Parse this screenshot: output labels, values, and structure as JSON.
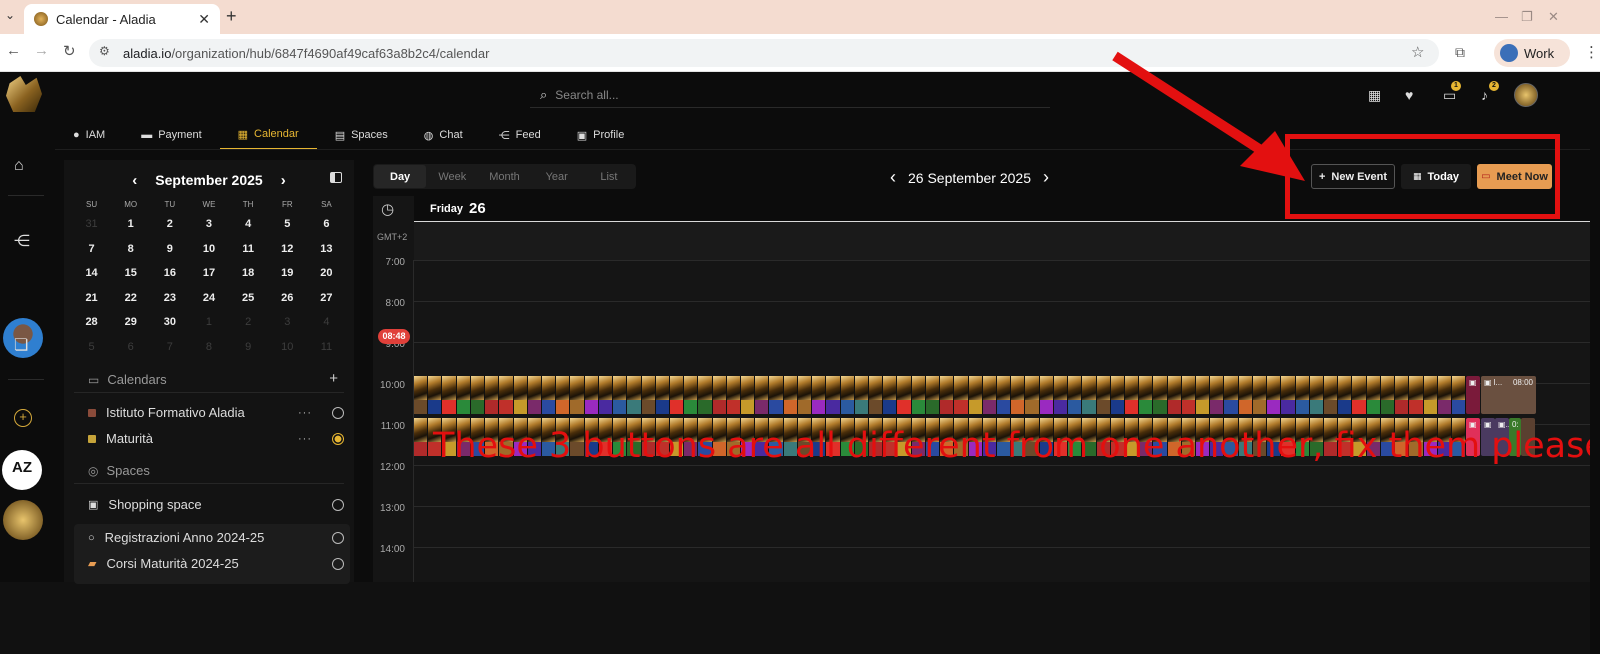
{
  "browser": {
    "tab_title": "Calendar - Aladia",
    "url_host": "aladia.io",
    "url_path": "/organization/hub/6847f4690af49caf63a8b2c4/calendar",
    "profile_label": "Work"
  },
  "header": {
    "search_placeholder": "Search all...",
    "chat_badge": "1",
    "notif_badge": "2"
  },
  "nav_tabs": [
    {
      "label": "IAM",
      "icon": "user-icon"
    },
    {
      "label": "Payment",
      "icon": "card-icon"
    },
    {
      "label": "Calendar",
      "icon": "calendar-icon",
      "active": true
    },
    {
      "label": "Spaces",
      "icon": "spaces-icon"
    },
    {
      "label": "Chat",
      "icon": "chat-icon"
    },
    {
      "label": "Feed",
      "icon": "share-icon"
    },
    {
      "label": "Profile",
      "icon": "profile-card-icon"
    }
  ],
  "mini_calendar": {
    "month_label": "September 2025",
    "weekdays": [
      "SU",
      "MO",
      "TU",
      "WE",
      "TH",
      "FR",
      "SA"
    ],
    "days": [
      {
        "d": "31",
        "dim": true
      },
      {
        "d": "1"
      },
      {
        "d": "2"
      },
      {
        "d": "3"
      },
      {
        "d": "4"
      },
      {
        "d": "5"
      },
      {
        "d": "6"
      },
      {
        "d": "7"
      },
      {
        "d": "8"
      },
      {
        "d": "9"
      },
      {
        "d": "10"
      },
      {
        "d": "11"
      },
      {
        "d": "12"
      },
      {
        "d": "13"
      },
      {
        "d": "14"
      },
      {
        "d": "15"
      },
      {
        "d": "16"
      },
      {
        "d": "17"
      },
      {
        "d": "18"
      },
      {
        "d": "19"
      },
      {
        "d": "20"
      },
      {
        "d": "21"
      },
      {
        "d": "22"
      },
      {
        "d": "23"
      },
      {
        "d": "24"
      },
      {
        "d": "25"
      },
      {
        "d": "26"
      },
      {
        "d": "27"
      },
      {
        "d": "28"
      },
      {
        "d": "29"
      },
      {
        "d": "30"
      },
      {
        "d": "1",
        "dim": true
      },
      {
        "d": "2",
        "dim": true
      },
      {
        "d": "3",
        "dim": true
      },
      {
        "d": "4",
        "dim": true
      },
      {
        "d": "5",
        "dim": true
      },
      {
        "d": "6",
        "dim": true
      },
      {
        "d": "7",
        "dim": true
      },
      {
        "d": "8",
        "dim": true
      },
      {
        "d": "9",
        "dim": true
      },
      {
        "d": "10",
        "dim": true
      },
      {
        "d": "11",
        "dim": true
      }
    ]
  },
  "calendars_section": {
    "title": "Calendars",
    "items": [
      {
        "label": "Istituto Formativo Aladia",
        "color": "#8a4b3a",
        "selected": false
      },
      {
        "label": "Maturità",
        "color": "#c6a43a",
        "selected": true
      }
    ]
  },
  "spaces_section": {
    "title": "Spaces",
    "items": [
      {
        "label": "Shopping space"
      },
      {
        "label": "Registrazioni Anno 2024-25"
      },
      {
        "label": "Corsi Maturità 2024-25"
      }
    ]
  },
  "view_tabs": [
    "Day",
    "Week",
    "Month",
    "Year",
    "List"
  ],
  "active_view": "Day",
  "current_date_label": "26 September 2025",
  "buttons": {
    "new_event": "New Event",
    "today": "Today",
    "meet_now": "Meet Now"
  },
  "day_header": {
    "weekday": "Friday",
    "day": "26"
  },
  "timezone": "GMT+2",
  "hours": [
    "7:00",
    "8:00",
    "9:00",
    "10:00",
    "11:00",
    "12:00",
    "13:00",
    "14:00"
  ],
  "now_label": "08:48",
  "event_labels": {
    "right_time": "08:00",
    "right_l": "l...",
    "right_dots": "0:",
    "right_ellipsis": "..."
  },
  "event_colors": [
    "#6b4a2a",
    "#c69a2a",
    "#2b5aa0",
    "#b02a2a",
    "#9a2ac0",
    "#2a8a3a",
    "#d0662a",
    "#1a3a8a",
    "#7a2a6a",
    "#3a7a7a",
    "#c0302a",
    "#4a2aa0",
    "#2a6a2a",
    "#a06a2a",
    "#e0302a",
    "#2a4aa0"
  ],
  "annotation": "These 3 buttons are all different from one another, fix them please."
}
